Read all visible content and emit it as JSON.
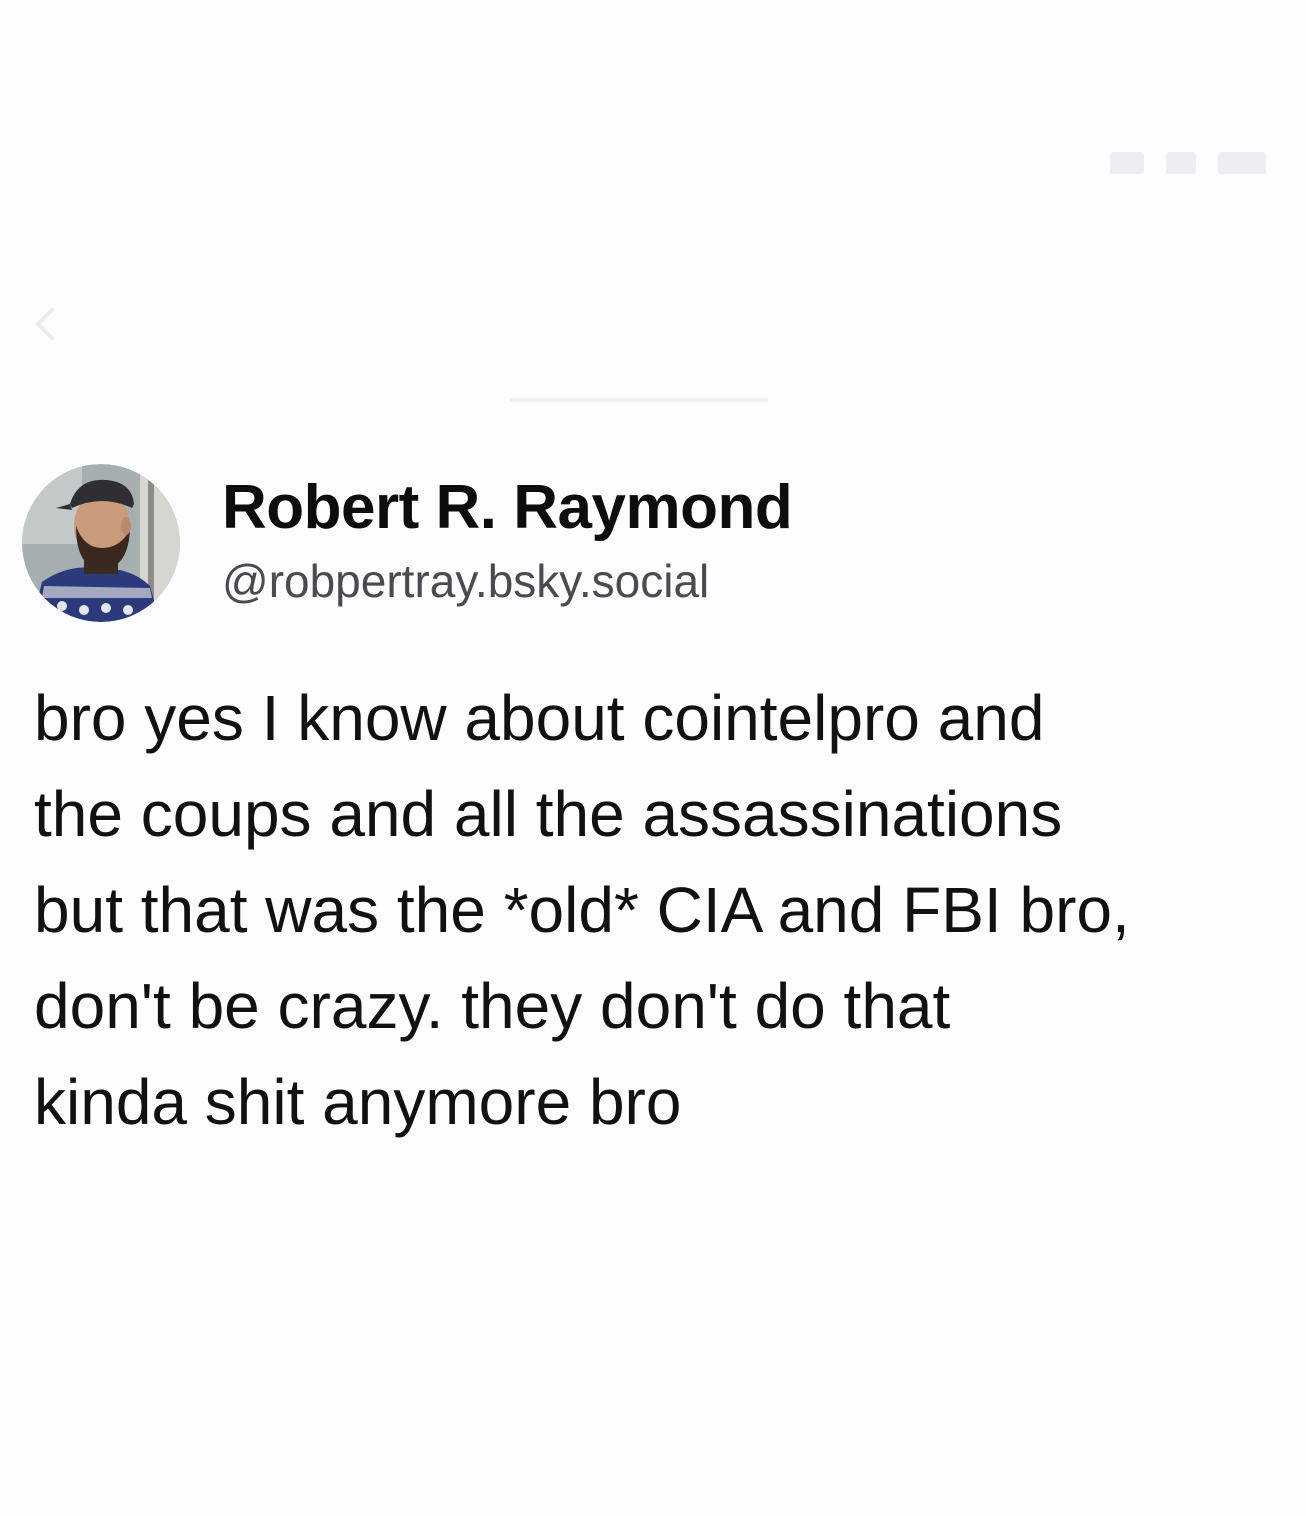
{
  "post": {
    "author_name": "Robert R. Raymond",
    "author_handle": "@robpertray.bsky.social",
    "text": "bro yes I know about cointelpro and\nthe coups and all the assassinations\nbut that was the *old* CIA and FBI bro,\ndon't be crazy. they don't do that\nkinda shit anymore bro"
  },
  "icons": {
    "back": "chevron-left-icon",
    "signal": "signal-icon",
    "wifi": "wifi-icon",
    "battery": "battery-icon"
  },
  "colors": {
    "background": "#fdfcfe",
    "text": "#111111",
    "handle": "#4a4b51",
    "faded_ui": "#ebeaee"
  }
}
